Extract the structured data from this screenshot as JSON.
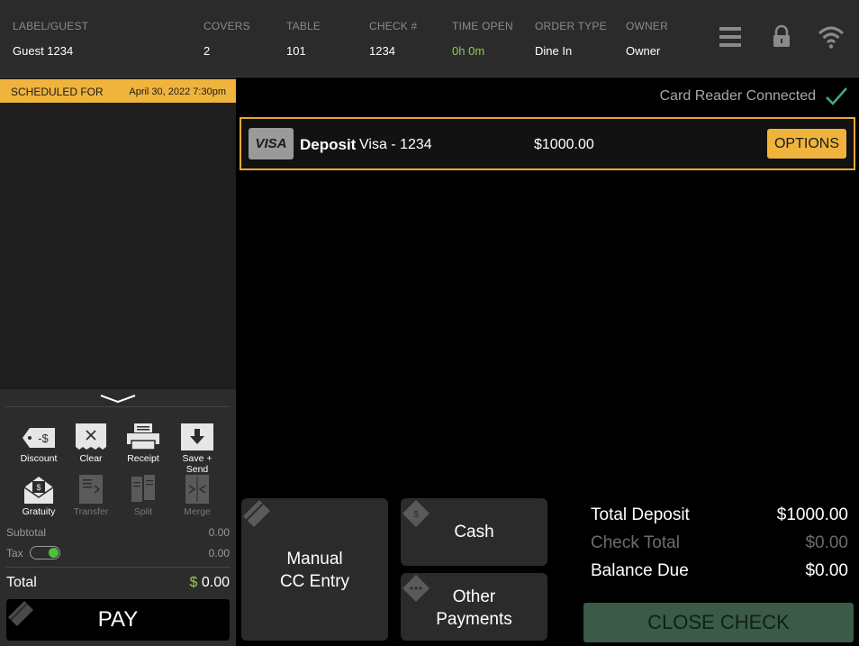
{
  "header": {
    "label_guest": {
      "label": "LABEL/GUEST",
      "value": "Guest 1234"
    },
    "covers": {
      "label": "COVERS",
      "value": "2"
    },
    "table": {
      "label": "TABLE",
      "value": "101"
    },
    "check_number": {
      "label": "CHECK #",
      "value": "1234"
    },
    "time_open": {
      "label": "TIME OPEN",
      "hours": "0",
      "h_unit": "h",
      "minutes": "0",
      "m_unit": "m"
    },
    "order_type": {
      "label": "ORDER TYPE",
      "value": "Dine In"
    },
    "owner": {
      "label": "OWNER",
      "value": "Owner"
    },
    "icons": [
      "menu-icon",
      "lock-icon",
      "wifi-icon"
    ]
  },
  "scheduled": {
    "label": "SCHEDULED FOR",
    "value": "April 30, 2022 7:30pm"
  },
  "tools": {
    "discount": "Discount",
    "clear": "Clear",
    "receipt": "Receipt",
    "save_send": "Save + Send",
    "gratuity": "Gratuity",
    "transfer": "Transfer",
    "split": "Split",
    "merge": "Merge"
  },
  "summary": {
    "subtotal_label": "Subtotal",
    "subtotal_value": "0.00",
    "tax_label": "Tax",
    "tax_value": "0.00",
    "tax_enabled": true,
    "total_label": "Total",
    "total_currency": "$",
    "total_value": "0.00"
  },
  "pay_label": "PAY",
  "card_reader": {
    "status": "Card Reader Connected"
  },
  "payments": [
    {
      "brand": "VISA",
      "type": "Deposit",
      "card": "Visa - 1234",
      "amount": "$1000.00",
      "options_label": "OPTIONS"
    }
  ],
  "payment_buttons": {
    "manual_cc_line1": "Manual",
    "manual_cc_line2": "CC Entry",
    "cash": "Cash",
    "other_line1": "Other",
    "other_line2": "Payments"
  },
  "totals": {
    "total_deposit_label": "Total Deposit",
    "total_deposit_value": "$1000.00",
    "check_total_label": "Check Total",
    "check_total_value": "$0.00",
    "balance_due_label": "Balance Due",
    "balance_due_value": "$0.00"
  },
  "close_check_label": "CLOSE CHECK",
  "colors": {
    "accent": "#f0b43c",
    "close_check": "#3b5a48",
    "toggle_on": "#4fc03a",
    "time_green": "#8ed14a",
    "check_green": "#3cae7a"
  }
}
